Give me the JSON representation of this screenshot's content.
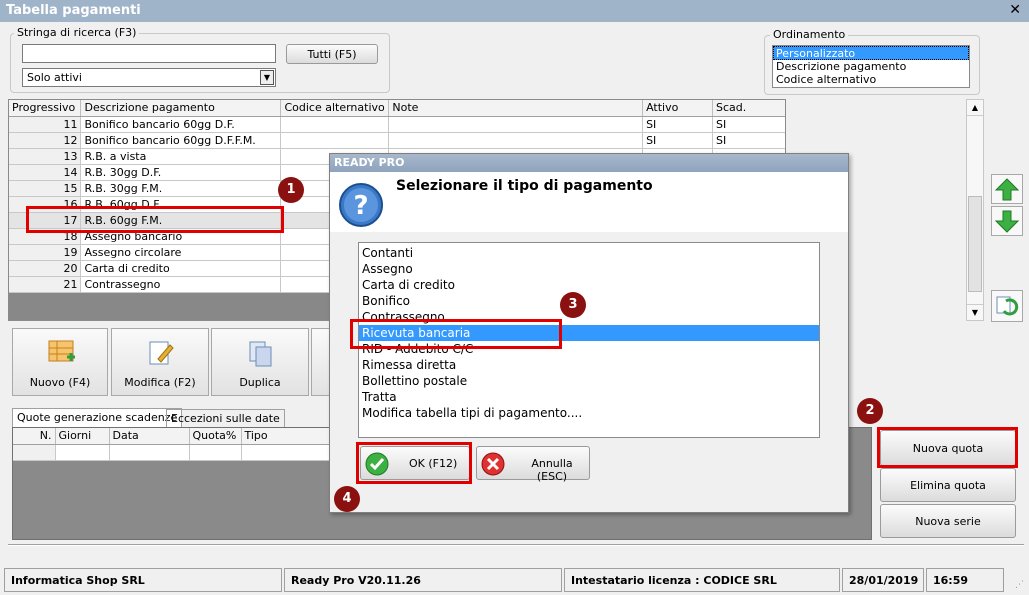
{
  "window": {
    "title": "Tabella pagamenti"
  },
  "search": {
    "group_label": "Stringa di ricerca (F3)",
    "input_value": "",
    "all_button": "Tutti (F5)",
    "filter_value": "Solo attivi"
  },
  "ordering": {
    "group_label": "Ordinamento",
    "options": [
      "Personalizzato",
      "Descrizione pagamento",
      "Codice alternativo"
    ]
  },
  "grid": {
    "headers": [
      "Progressivo",
      "Descrizione pagamento",
      "Codice alternativo",
      "Note",
      "Attivo",
      "Scad."
    ],
    "rows": [
      {
        "n": "11",
        "desc": "Bonifico bancario 60gg D.F.",
        "code": "",
        "note": "",
        "active": "SI",
        "scad": "SI"
      },
      {
        "n": "12",
        "desc": "Bonifico bancario 60gg D.F.F.M.",
        "code": "",
        "note": "",
        "active": "SI",
        "scad": "SI"
      },
      {
        "n": "13",
        "desc": "R.B. a vista",
        "code": "",
        "note": "",
        "active": "",
        "scad": ""
      },
      {
        "n": "14",
        "desc": "R.B. 30gg D.F.",
        "code": "",
        "note": "",
        "active": "",
        "scad": ""
      },
      {
        "n": "15",
        "desc": "R.B. 30gg F.M.",
        "code": "",
        "note": "",
        "active": "",
        "scad": ""
      },
      {
        "n": "16",
        "desc": "R.B. 60gg D.F.",
        "code": "",
        "note": "",
        "active": "",
        "scad": ""
      },
      {
        "n": "17",
        "desc": "R.B. 60gg F.M.",
        "code": "",
        "note": "",
        "active": "",
        "scad": ""
      },
      {
        "n": "18",
        "desc": "Assegno bancario",
        "code": "",
        "note": "",
        "active": "",
        "scad": ""
      },
      {
        "n": "19",
        "desc": "Assegno circolare",
        "code": "",
        "note": "",
        "active": "",
        "scad": ""
      },
      {
        "n": "20",
        "desc": "Carta di credito",
        "code": "",
        "note": "",
        "active": "",
        "scad": ""
      },
      {
        "n": "21",
        "desc": "Contrassegno",
        "code": "",
        "note": "",
        "active": "",
        "scad": ""
      }
    ]
  },
  "toolbar": {
    "new": "Nuovo (F4)",
    "edit": "Modifica (F2)",
    "duplicate": "Duplica"
  },
  "tabs": [
    "Quote generazione scadenze",
    "Eccezioni sulle date"
  ],
  "quote_grid": {
    "headers": [
      "N.",
      "Giorni",
      "Data",
      "Quota%",
      "Tipo"
    ]
  },
  "right_buttons": {
    "new_quota": "Nuova quota",
    "delete_quota": "Elimina quota",
    "new_series": "Nuova serie"
  },
  "dialog": {
    "title": "READY PRO",
    "prompt": "Selezionare il tipo di pagamento",
    "items": [
      "Contanti",
      "Assegno",
      "Carta di credito",
      "Bonifico",
      "Contrassegno",
      "Ricevuta bancaria",
      "RID - Addebito C/C",
      "Rimessa diretta",
      "Bollettino postale",
      "Tratta",
      "Modifica tabella tipi di pagamento...."
    ],
    "selected_index": 5,
    "ok": "OK (F12)",
    "cancel": "Annulla (ESC)"
  },
  "badges": [
    "1",
    "2",
    "3",
    "4"
  ],
  "status": {
    "company": "Informatica Shop SRL",
    "version": "Ready Pro V20.11.26",
    "license": "Intestatario licenza : CODICE SRL",
    "date": "28/01/2019",
    "time": "16:59"
  },
  "colors": {
    "annotation_red": "#e00000",
    "badge": "#8b1010",
    "selection": "#3399ff"
  }
}
